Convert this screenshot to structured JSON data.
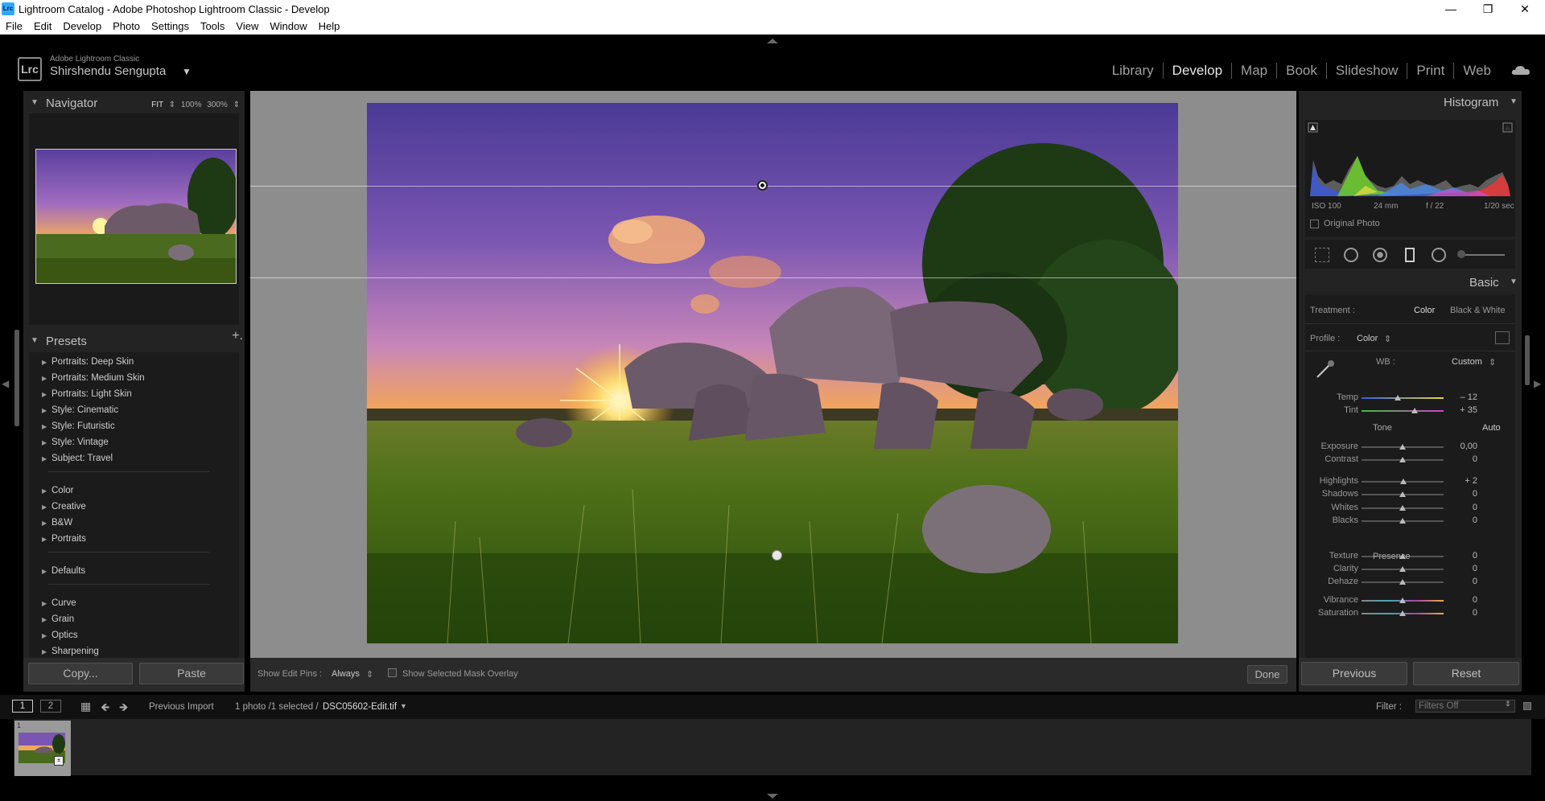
{
  "window": {
    "title": "Lightroom Catalog - Adobe Photoshop Lightroom Classic - Develop",
    "app_icon": "Lrc"
  },
  "menu": [
    "File",
    "Edit",
    "Develop",
    "Photo",
    "Settings",
    "Tools",
    "View",
    "Window",
    "Help"
  ],
  "identity": {
    "product": "Adobe Lightroom Classic",
    "user": "Shirshendu Sengupta",
    "badge": "Lrc"
  },
  "modules": [
    {
      "label": "Library",
      "active": false
    },
    {
      "label": "Develop",
      "active": true
    },
    {
      "label": "Map",
      "active": false
    },
    {
      "label": "Book",
      "active": false
    },
    {
      "label": "Slideshow",
      "active": false
    },
    {
      "label": "Print",
      "active": false
    },
    {
      "label": "Web",
      "active": false
    }
  ],
  "navigator": {
    "title": "Navigator",
    "zoom_options": [
      "FIT",
      "100%",
      "300%"
    ]
  },
  "presets": {
    "title": "Presets",
    "group1": [
      "Portraits: Deep Skin",
      "Portraits: Medium Skin",
      "Portraits: Light Skin",
      "Style: Cinematic",
      "Style: Futuristic",
      "Style: Vintage",
      "Subject: Travel"
    ],
    "group2": [
      "Color",
      "Creative",
      "B&W",
      "Portraits"
    ],
    "group3": [
      "Defaults"
    ],
    "group4": [
      "Curve",
      "Grain",
      "Optics",
      "Sharpening"
    ]
  },
  "left_buttons": {
    "copy": "Copy...",
    "paste": "Paste"
  },
  "toolbar": {
    "show_edit_pins": "Show Edit Pins :",
    "pins_value": "Always",
    "mask_overlay": "Show Selected Mask Overlay",
    "done": "Done"
  },
  "histogram": {
    "title": "Histogram",
    "iso": "ISO 100",
    "focal": "24 mm",
    "aperture": "f / 22",
    "shutter": "1/20 sec",
    "original_photo": "Original Photo"
  },
  "basic": {
    "title": "Basic",
    "treatment_label": "Treatment :",
    "treatment_color": "Color",
    "treatment_bw": "Black & White",
    "profile_label": "Profile :",
    "profile_value": "Color",
    "wb_label": "WB :",
    "wb_value": "Custom",
    "tone_label": "Tone",
    "auto_label": "Auto",
    "presence_label": "Presence",
    "temp": {
      "label": "Temp",
      "value": "– 12",
      "pos": 0.44
    },
    "tint": {
      "label": "Tint",
      "value": "+ 35",
      "pos": 0.65
    },
    "exposure": {
      "label": "Exposure",
      "value": "0,00",
      "pos": 0.5
    },
    "contrast": {
      "label": "Contrast",
      "value": "0",
      "pos": 0.5
    },
    "highlights": {
      "label": "Highlights",
      "value": "+ 2",
      "pos": 0.51
    },
    "shadows": {
      "label": "Shadows",
      "value": "0",
      "pos": 0.5
    },
    "whites": {
      "label": "Whites",
      "value": "0",
      "pos": 0.5
    },
    "blacks": {
      "label": "Blacks",
      "value": "0",
      "pos": 0.5
    },
    "texture": {
      "label": "Texture",
      "value": "0",
      "pos": 0.5
    },
    "clarity": {
      "label": "Clarity",
      "value": "0",
      "pos": 0.5
    },
    "dehaze": {
      "label": "Dehaze",
      "value": "0",
      "pos": 0.5
    },
    "vibrance": {
      "label": "Vibrance",
      "value": "0",
      "pos": 0.5
    },
    "saturation": {
      "label": "Saturation",
      "value": "0",
      "pos": 0.5
    }
  },
  "right_buttons": {
    "previous": "Previous",
    "reset": "Reset"
  },
  "filmbar": {
    "view1": "1",
    "view2": "2",
    "source": "Previous Import",
    "count": "1 photo /1 selected /",
    "filename": "DSC05602-Edit.tif",
    "filter_label": "Filter :",
    "filter_value": "Filters Off",
    "thumb_index": "1"
  },
  "colors": {
    "accent": "#31a8ff",
    "panel": "#232323",
    "canvas": "#8d8d8d"
  }
}
